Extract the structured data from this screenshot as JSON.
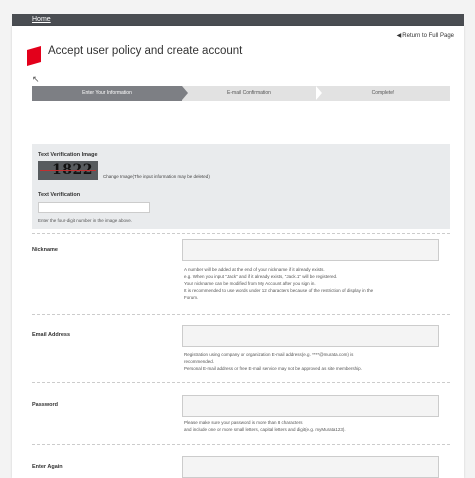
{
  "top_nav": {
    "home_link": "Home"
  },
  "header": {
    "title": "Accept user policy and create account",
    "return_link": "Return to Full Page"
  },
  "steps": [
    {
      "label": "Enter Your Information",
      "state": "active"
    },
    {
      "label": "E-mail Confirmation",
      "state": "inactive"
    },
    {
      "label": "Complete!",
      "state": "inactive"
    }
  ],
  "text_verification": {
    "image_label": "Text Verification Image",
    "captcha_text": "1822",
    "change_link": "Change Image(The input information may be deleted)",
    "input_label": "Text Verification",
    "input_value": "",
    "hint": "Enter the four-digit number in the image above."
  },
  "nickname": {
    "label": "Nickname",
    "value": "",
    "notes": [
      "A number will be added at the end of your nickname if it already exists.",
      "e.g. When you input \"Jack\" and if it already exists, \"Jack.1\" will be registered.",
      "Your nickname can be modified from My Account after you sign in.",
      "It is recommended to use words under 12 characters because of the restriction of display in the",
      "Forum."
    ]
  },
  "email": {
    "label": "Email Address",
    "value": "",
    "notes": [
      "Registration using company or organization E-mail address(e.g. ****@murata.com) is",
      "recommended.",
      "Personal E-mail address or free E-mail service may not be approved as site membership."
    ]
  },
  "password": {
    "label": "Password",
    "value": "",
    "notes": [
      "Please make sure your password is more than 8 characters",
      "and include one or more small letters, capital letters and digit(e.g. myMurata123)."
    ]
  },
  "password_again": {
    "label": "Enter Again",
    "value": ""
  },
  "colors": {
    "brand_red": "#e3001b",
    "topbar": "#4a4d52",
    "active_step": "#7d7f84"
  }
}
